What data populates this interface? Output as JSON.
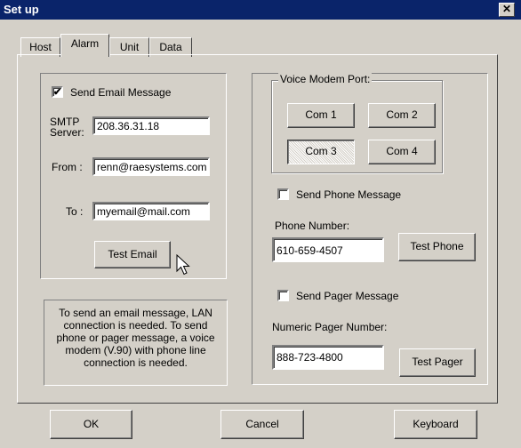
{
  "window": {
    "title": "Set up"
  },
  "tabs": [
    {
      "label": "Host"
    },
    {
      "label": "Alarm"
    },
    {
      "label": "Unit"
    },
    {
      "label": "Data"
    }
  ],
  "email": {
    "send_label": "Send Email Message",
    "send_checked": true,
    "smtp_label_line1": "SMTP",
    "smtp_label_line2": "Server:",
    "smtp_value": "208.36.31.18",
    "from_label": "From :",
    "from_value": "renn@raesystems.com",
    "to_label": "To :",
    "to_value": "myemail@mail.com",
    "test_button": "Test Email"
  },
  "info_text": "To send an email message, LAN connection is needed. To send phone or pager message, a voice modem (V.90) with phone line connection is needed.",
  "modem": {
    "group_title": "Voice Modem Port:",
    "ports": [
      "Com 1",
      "Com 2",
      "Com 3",
      "Com 4"
    ],
    "selected": "Com 3"
  },
  "phone": {
    "send_label": "Send Phone Message",
    "send_checked": false,
    "number_label": "Phone Number:",
    "number_value": "610-659-4507",
    "test_button": "Test Phone"
  },
  "pager": {
    "send_label": "Send Pager Message",
    "send_checked": false,
    "number_label": "Numeric Pager Number:",
    "number_value": "888-723-4800",
    "test_button": "Test Pager"
  },
  "footer": {
    "ok": "OK",
    "cancel": "Cancel",
    "keyboard": "Keyboard"
  },
  "icons": {
    "close": "close-icon",
    "cursor": "mouse-pointer-icon"
  }
}
